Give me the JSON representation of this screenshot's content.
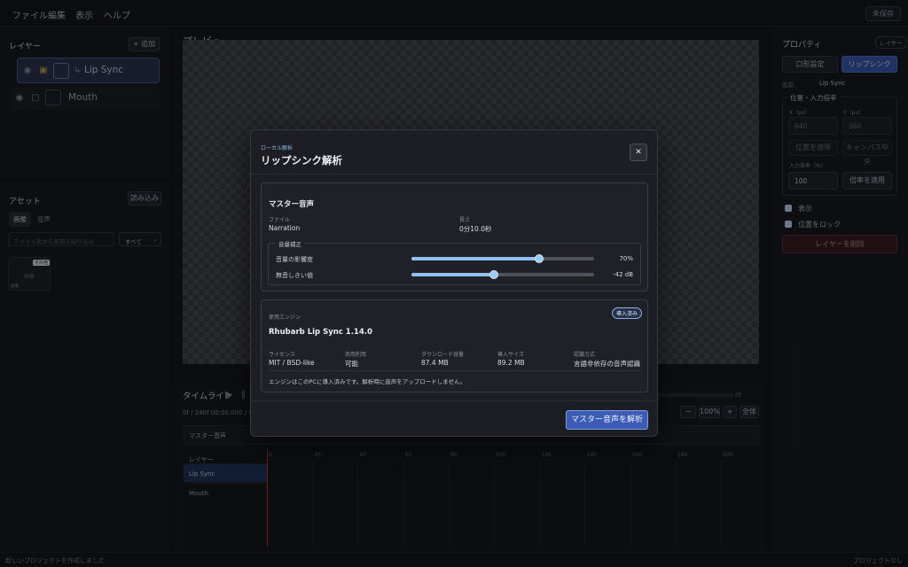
{
  "menubar": {
    "items": [
      "ファイル",
      "編集",
      "表示",
      "ヘルプ"
    ],
    "unsaved": "未保存"
  },
  "layers": {
    "title": "レイヤー",
    "add_button": "+ 追加",
    "items": [
      {
        "name": "Lip Sync",
        "prefix": "↳",
        "selected": true
      },
      {
        "name": "Mouth",
        "prefix": "",
        "selected": false
      }
    ]
  },
  "assets": {
    "title": "アセット",
    "import_button": "読み込み",
    "tabs": [
      "画像",
      "音声"
    ],
    "search_placeholder": "ファイル名から名前を絞り込み",
    "filter_value": "すべて",
    "tile": {
      "badge": "その他",
      "name": "画像",
      "sub": "画像"
    }
  },
  "preview": {
    "title": "プレビュー"
  },
  "timeline": {
    "title": "タイムライン",
    "frame_info": "0f / 240f  00:00.000 / 0",
    "end_label": "0f",
    "zoom_minus": "−",
    "zoom_value": "100%",
    "zoom_plus": "+",
    "fit_button": "全体",
    "master_track": "マスター音声",
    "layer_header": "レイヤー",
    "rows": [
      "Lip Sync",
      "Mouth"
    ],
    "ticks": [
      "0",
      "20",
      "40",
      "60",
      "80",
      "100",
      "120",
      "140",
      "160",
      "180",
      "200"
    ]
  },
  "properties": {
    "title": "プロパティ",
    "badge": "レイヤー",
    "tabs": [
      "口形設定",
      "リップシンク"
    ],
    "active_tab": 1,
    "name_label": "名前",
    "name_value": "Lip Sync",
    "position_section": "位置・入力倍率",
    "x_label": "X（px）",
    "x_value": "640",
    "y_label": "Y（px）",
    "y_value": "360",
    "apply_position": "位置を適用",
    "center_canvas": "キャンバス中央",
    "scale_label": "入力倍率（%）",
    "scale_value": "100",
    "apply_scale": "倍率を適用",
    "show_label": "表示",
    "lock_label": "位置をロック",
    "delete_button": "レイヤーを削除"
  },
  "modal": {
    "kicker": "ローカル解析",
    "title": "リップシンク解析",
    "close": "✕",
    "master": {
      "heading": "マスター音声",
      "file_label": "ファイル",
      "file_value": "Narration",
      "length_label": "長さ",
      "length_value": "0分10.0秒",
      "correction_legend": "音量補正",
      "sliders": [
        {
          "label": "音量の影響度",
          "value_text": "70%",
          "fraction": 0.7
        },
        {
          "label": "無音しきい値",
          "value_text": "-42 dB",
          "fraction": 0.45
        }
      ]
    },
    "engine": {
      "label": "使用エンジン",
      "badge": "導入済み",
      "name": "Rhubarb Lip Sync 1.14.0",
      "stats": [
        {
          "label": "ライセンス",
          "value": "MIT / BSD-like"
        },
        {
          "label": "商用利用",
          "value": "可能"
        },
        {
          "label": "ダウンロード容量",
          "value": "87.4 MB"
        },
        {
          "label": "導入サイズ",
          "value": "89.2 MB"
        },
        {
          "label": "認識方式",
          "value": "言語非依存の音声認識"
        }
      ],
      "note": "エンジンはこのPCに導入済みです。解析時に音声をアップロードしません。"
    },
    "analyze_button": "マスター音声を解析"
  },
  "statusbar": {
    "left": "新しいプロジェクトを作成しました",
    "right": "プロジェクトなし"
  },
  "colors": {
    "accent": "#3b5bb5",
    "danger": "#3a1f24",
    "selected_layer": "#2a3550"
  }
}
